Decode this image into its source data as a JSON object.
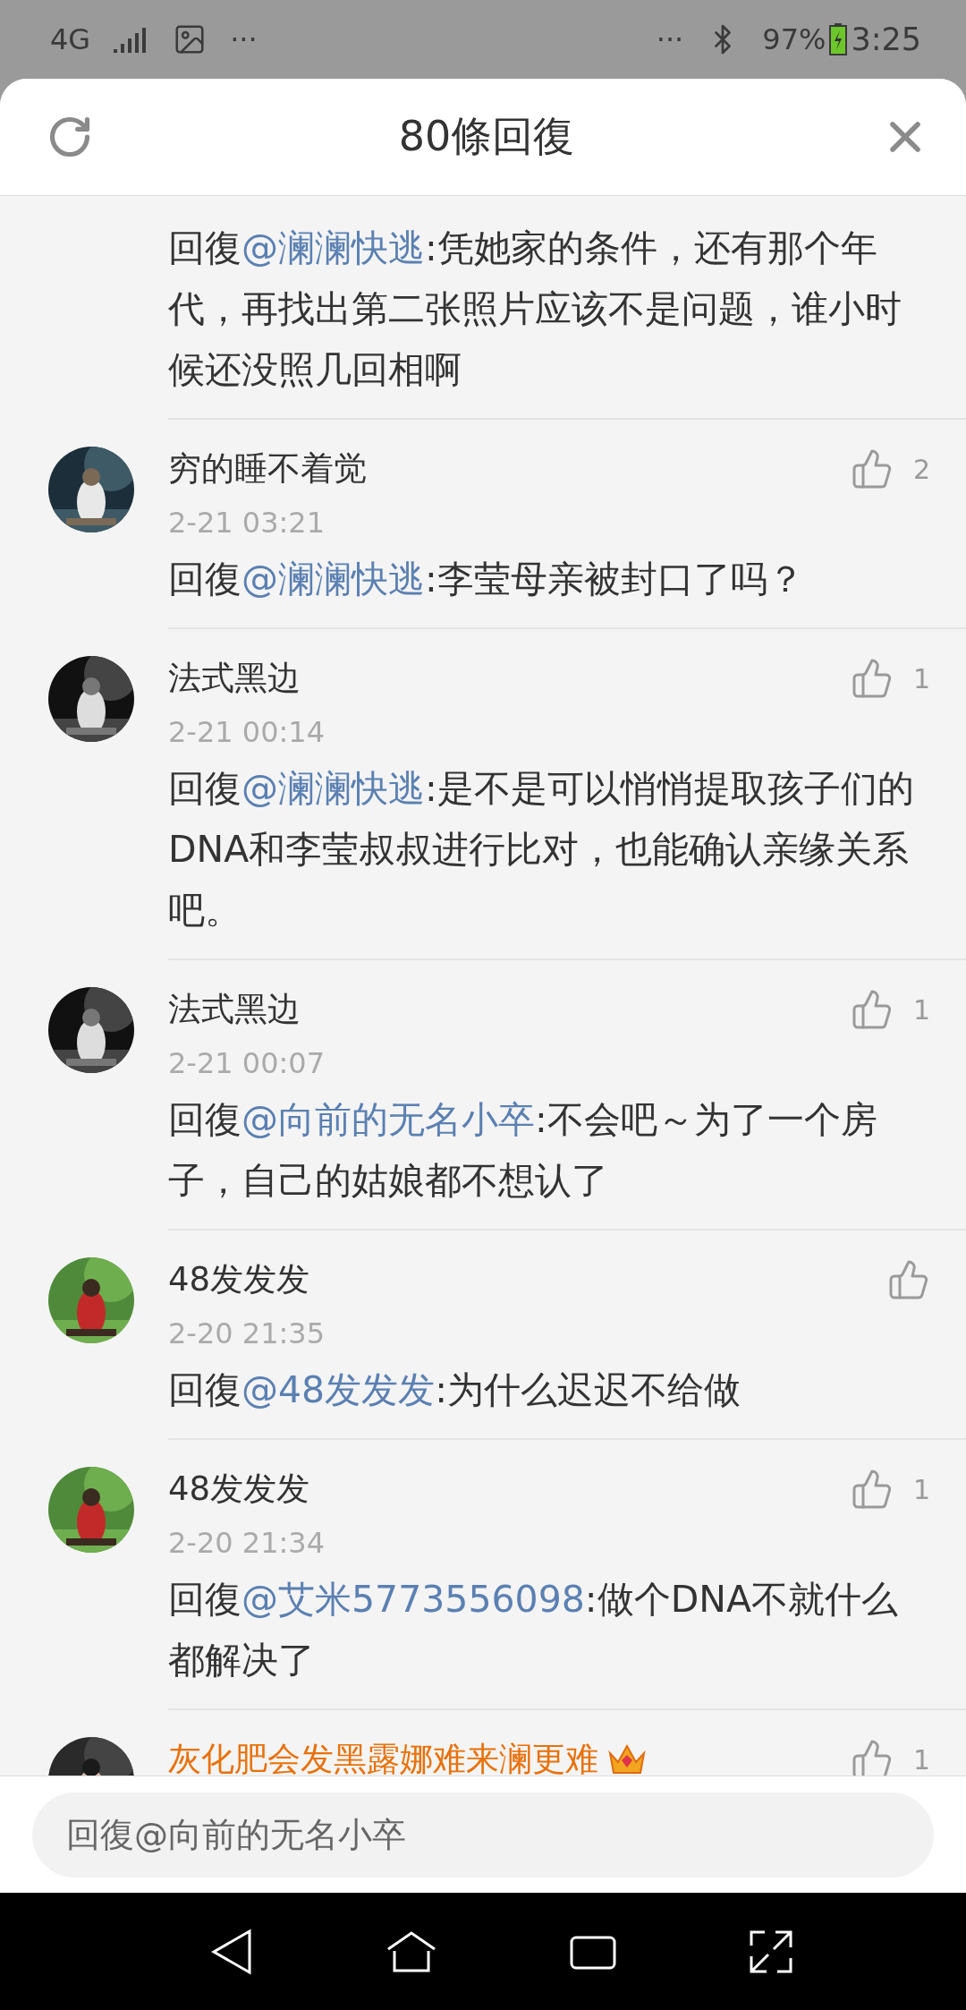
{
  "status_bar": {
    "network": "4G",
    "dots_left": "···",
    "dots_right": "···",
    "battery": "97%",
    "time": "3:25"
  },
  "header": {
    "title": "80條回復"
  },
  "comments": [
    {
      "prefix": "回復",
      "mention": "@澜澜快逃",
      "text": ":凭她家的条件，还有那个年代，再找出第二张照片应该不是问题，谁小时候还没照几回相啊"
    },
    {
      "name": "穷的睡不着觉",
      "vip": false,
      "time": "2-21 03:21",
      "likes": "2",
      "prefix": "回復",
      "mention": "@澜澜快逃",
      "text": ":李莹母亲被封口了吗？"
    },
    {
      "name": "法式黑边",
      "vip": false,
      "time": "2-21 00:14",
      "likes": "1",
      "prefix": "回復",
      "mention": "@澜澜快逃",
      "text": ":是不是可以悄悄提取孩子们的DNA和李莹叔叔进行比对，也能确认亲缘关系吧。"
    },
    {
      "name": "法式黑边",
      "vip": false,
      "time": "2-21 00:07",
      "likes": "1",
      "prefix": "回復",
      "mention": "@向前的无名小卒",
      "text": ":不会吧～为了一个房子，自己的姑娘都不想认了"
    },
    {
      "name": "48发发发",
      "vip": false,
      "time": "2-20 21:35",
      "prefix": "回復",
      "mention": "@48发发发",
      "text": ":为什么迟迟不给做"
    },
    {
      "name": "48发发发",
      "vip": false,
      "time": "2-20 21:34",
      "likes": "1",
      "prefix": "回復",
      "mention": "@艾米5773556098",
      "text": ":做个DNA不就什么都解决了"
    },
    {
      "name": "灰化肥会发黑露娜难来澜更难",
      "vip": true,
      "likes": "1"
    }
  ],
  "reply_box": {
    "placeholder": "回復@向前的无名小卒"
  }
}
